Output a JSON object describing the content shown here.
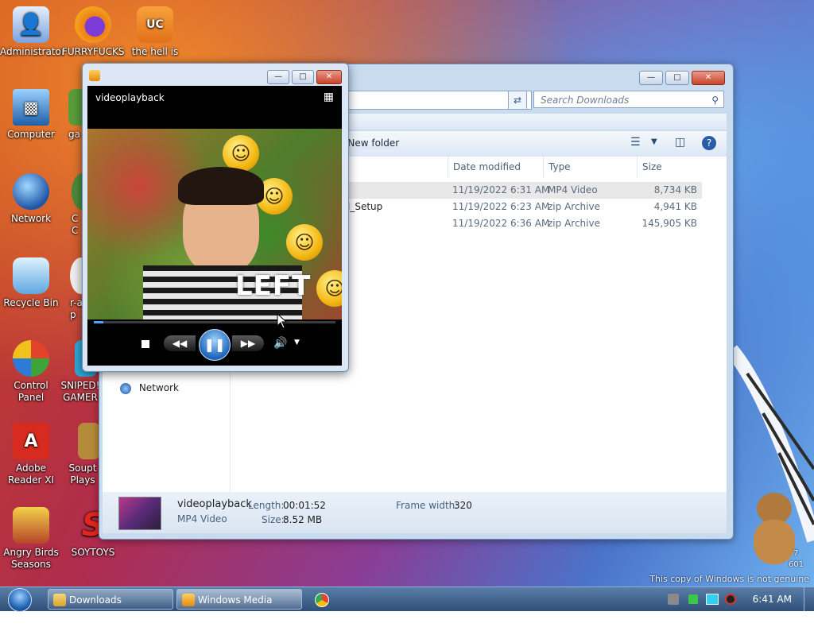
{
  "desktop": {
    "icons": [
      {
        "label": "Administrator",
        "icon": "user-folder-icon",
        "color": "#3b6db3"
      },
      {
        "label": "Computer",
        "icon": "computer-icon",
        "color": "#2e6fb5"
      },
      {
        "label": "Network",
        "icon": "network-globe-icon",
        "color": "#2a5ea8"
      },
      {
        "label": "Recycle Bin",
        "icon": "recycle-bin-icon",
        "color": "#3a88c9"
      },
      {
        "label": "Control Panel",
        "icon": "control-panel-icon",
        "color": "#d9472b"
      },
      {
        "label": "Adobe Reader XI",
        "icon": "adobe-reader-icon",
        "color": "#d62b1e"
      },
      {
        "label": "Angry Birds Seasons",
        "icon": "angry-birds-icon",
        "color": "#c9a13a"
      },
      {
        "label": "FURRYFUCKS",
        "icon": "firefox-icon",
        "color": "#ef7d1a"
      },
      {
        "label": "ga",
        "icon": "app-icon",
        "color": "#5a9c3a"
      },
      {
        "label": "C\nC",
        "icon": "app-icon",
        "color": "#4a8a3a"
      },
      {
        "label": "r-a\np",
        "icon": "app-icon",
        "color": "#eeeeee"
      },
      {
        "label": "SNIPED!\nGAMER",
        "icon": "app-icon",
        "color": "#2fa8d8"
      },
      {
        "label": "Soupt\nPlays",
        "icon": "app-icon",
        "color": "#b58a3a"
      },
      {
        "label": "SOYTOYS",
        "icon": "soytoys-icon",
        "color": "#e3261c"
      },
      {
        "label": "the hell is",
        "icon": "uc-browser-icon",
        "color": "#f28c1e"
      }
    ],
    "watermark": "This copy of Windows is not genuine",
    "watermark_extra": [
      "7",
      "601"
    ]
  },
  "explorer": {
    "search_placeholder": "Search Downloads",
    "toolbar": {
      "new_folder": "New folder"
    },
    "columns": [
      "Date modified",
      "Type",
      "Size"
    ],
    "files": [
      {
        "name": "",
        "date": "11/19/2022 6:31 AM",
        "type": "MP4 Video",
        "size": "8,734 KB",
        "selected": true
      },
      {
        "name": "l_Setup",
        "date": "11/19/2022 6:23 AM",
        "type": "zip Archive",
        "size": "4,941 KB",
        "selected": false
      },
      {
        "name": "",
        "date": "11/19/2022 6:36 AM",
        "type": "zip Archive",
        "size": "145,905 KB",
        "selected": false
      }
    ],
    "nav": {
      "network": "Network"
    },
    "details": {
      "name": "videoplayback",
      "type": "MP4 Video",
      "length_label": "Length:",
      "length": "00:01:52",
      "size_label": "Size:",
      "size": "8.52 MB",
      "frame_label": "Frame width:",
      "frame_width": "320"
    }
  },
  "player": {
    "title": "videoplayback",
    "video_overlay_text": "LEFT",
    "progress": 0.04,
    "accent": "#4aa3ff"
  },
  "taskbar": {
    "items": [
      {
        "label": "Downloads",
        "icon": "folder-icon"
      },
      {
        "label": "Windows Media Player",
        "icon": "media-player-icon"
      },
      {
        "label": "",
        "icon": "chrome-icon"
      }
    ],
    "clock": "6:41 AM"
  }
}
